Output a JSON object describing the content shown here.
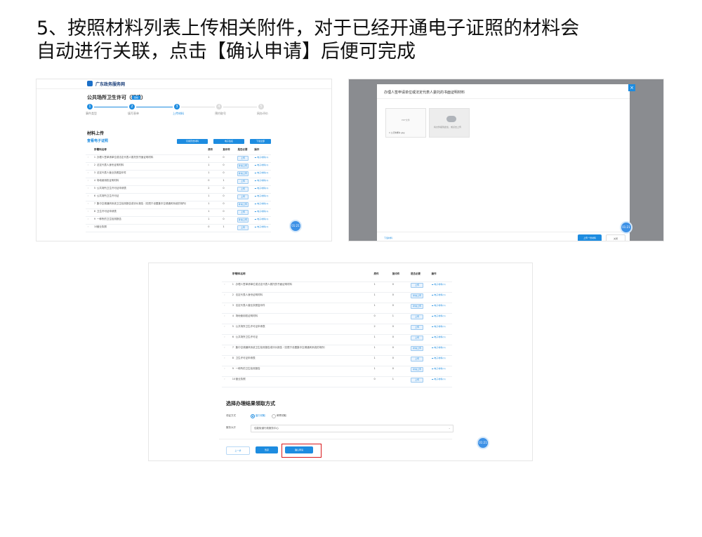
{
  "caption": {
    "line1": "5、按照材料列表上传相关附件，对于已经开通电子证照的材料会",
    "line2": "自动进行关联，点击【确认申请】后便可完成"
  },
  "site": {
    "name": "广东政务服务网"
  },
  "form": {
    "title": "公共场所卫生许可（延续）",
    "badge": "延续"
  },
  "steps": [
    "事件类型",
    "填写表单",
    "上传材料",
    "预约取号",
    "网办评价"
  ],
  "steps_done": 3,
  "materials": {
    "section": "材料上传",
    "ecert": "查看电子证照",
    "buttons": {
      "reuse": "引用历史材料",
      "sign": "电子签名",
      "download": "下载全部"
    },
    "columns": [
      "序号",
      "材料名称",
      "原件",
      "复印件",
      "是否必要",
      "操作"
    ],
    "rows": [
      {
        "no": "1",
        "name": "办理人签单请单位或法定代表人委托的书面证明材料",
        "orig": "1",
        "copy": "0",
        "action": "上传",
        "link": "电子材料(1)"
      },
      {
        "no": "2",
        "name": "法定代表人身份证明材料",
        "orig": "1",
        "copy": "0",
        "action": "补充上传",
        "link": "电子材料(1)"
      },
      {
        "no": "3",
        "name": "法定代表人营业执照复印件",
        "orig": "1",
        "copy": "0",
        "action": "补充上传",
        "link": "电子材料(1)"
      },
      {
        "no": "4",
        "name": "场地使用权证明材料",
        "orig": "0",
        "copy": "1",
        "action": "上传",
        "link": "电子材料(1)"
      },
      {
        "no": "5",
        "name": "公共场所卫生许可证申请表",
        "orig": "2",
        "copy": "0",
        "action": "上传",
        "link": "电子材料(1)"
      },
      {
        "no": "6",
        "name": "公共场所卫生许可证",
        "orig": "1",
        "copy": "0",
        "action": "上传",
        "link": "电子材料(1)"
      },
      {
        "no": "7",
        "name": "集中空调通风系统卫生检测报告或评价报告（仅限于设置集中空调通风系统的场所）",
        "orig": "1",
        "copy": "0",
        "action": "补充上传",
        "link": "电子材料(1)"
      },
      {
        "no": "8",
        "name": "卫生许可证申请表",
        "orig": "1",
        "copy": "0",
        "action": "上传",
        "link": "电子材料(1)"
      },
      {
        "no": "9",
        "name": "一种所的卫生检测报告",
        "orig": "1",
        "copy": "0",
        "action": "补充上传",
        "link": "电子材料(1)"
      },
      {
        "no": "10",
        "name": "营业执照",
        "orig": "0",
        "copy": "1",
        "action": "上传",
        "link": "电子材料(1)"
      }
    ]
  },
  "modal": {
    "title": "办理人签申请单位或法定代表人委托的书面证明材料",
    "file_thumb": "PDF文件",
    "file_name": "1 公示材料1.jpg",
    "upload_hint": "将文件拖到此处，或点击上传",
    "download": "下载材料",
    "confirm": "上传一份材料",
    "close": "关闭"
  },
  "result": {
    "title": "选择办理结果领取方式",
    "method_label": "领证方式",
    "options": [
      "窗口领取",
      "邮寄领取"
    ],
    "hall_label": "服务大厅",
    "hall_value": "佳能街道行政服务中心",
    "prev": "上一步",
    "save": "暂存",
    "submit": "确认申请"
  },
  "float": {
    "time": "01:21"
  }
}
